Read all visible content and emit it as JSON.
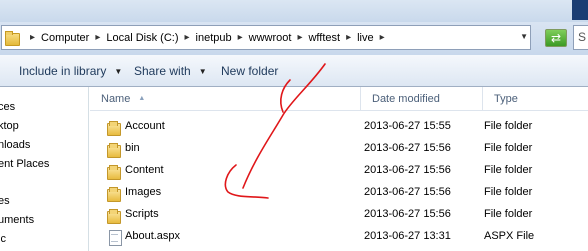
{
  "address": {
    "breadcrumbs": [
      "Computer",
      "Local Disk (C:)",
      "inetpub",
      "wwwroot",
      "wfftest",
      "live"
    ],
    "search_placeholder": "S"
  },
  "toolbar": {
    "include_in_library": "Include in library",
    "share_with": "Share with",
    "new_folder": "New folder"
  },
  "navigation": {
    "items": [
      "ces",
      "ktop",
      "nloads",
      "ent Places",
      "es",
      "uments",
      "ic"
    ]
  },
  "columns": {
    "name": "Name",
    "date_modified": "Date modified",
    "type": "Type"
  },
  "files": [
    {
      "name": "Account",
      "date": "2013-06-27 15:55",
      "type": "File folder",
      "icon": "folder-icon"
    },
    {
      "name": "bin",
      "date": "2013-06-27 15:56",
      "type": "File folder",
      "icon": "folder-icon"
    },
    {
      "name": "Content",
      "date": "2013-06-27 15:56",
      "type": "File folder",
      "icon": "folder-icon"
    },
    {
      "name": "Images",
      "date": "2013-06-27 15:56",
      "type": "File folder",
      "icon": "folder-icon"
    },
    {
      "name": "Scripts",
      "date": "2013-06-27 15:56",
      "type": "File folder",
      "icon": "folder-icon"
    },
    {
      "name": "About.aspx",
      "date": "2013-06-27 13:31",
      "type": "ASPX File",
      "icon": "file-icon"
    }
  ],
  "colors": {
    "annotation": "#e0171a",
    "toolbar_text": "#1e395b",
    "header_text": "#4c607a"
  }
}
